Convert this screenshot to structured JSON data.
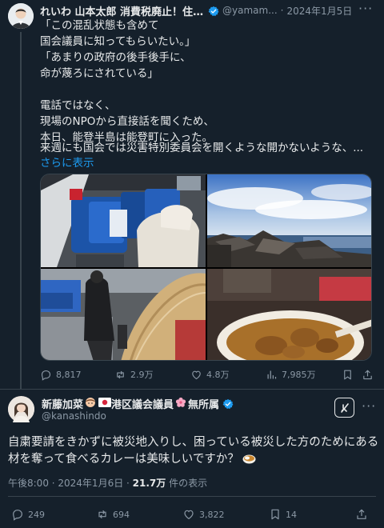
{
  "tweet1": {
    "name": "れいわ 山本太郎 消費税廃止！住ま...",
    "handle": "@yamam...",
    "date": "2024年1月5日",
    "lines": [
      "「この混乱状態も含めて",
      "国会議員に知ってもらいたい。」",
      "「あまりの政府の後手後手に、",
      "命が蔑ろにされている」",
      "",
      "電話ではなく、",
      "現場のNPOから直接話を聞くため、",
      "本日、能登半島は能登町に入った。",
      "",
      "来週にも国会では災害特別委員会を開くような開かないような、..."
    ],
    "show_more": "さらに表示",
    "stats": {
      "replies": "8,817",
      "reposts": "2.9万",
      "likes": "4.8万",
      "views": "7,985万"
    }
  },
  "tweet2": {
    "name": "新藤加菜",
    "name_suffix1": "港区議会議員",
    "name_suffix2": "無所属",
    "handle": "@kanashindo",
    "text_lines": [
      "自粛要請をきかずに被災地入りし、困っている被災した方のためにある食",
      "材を奪って食べるカレーは美味しいですか？"
    ],
    "time": "午後8:00 · 2024年1月6日 · ",
    "views_count": "21.7万",
    "views_label": " 件の表示",
    "stats": {
      "replies": "249",
      "reposts": "694",
      "likes": "3,822",
      "bookmarks": "14"
    }
  },
  "colors": {
    "background": "#15202b",
    "text": "#e7e9ea",
    "muted": "#8b98a5",
    "accent": "#1d9bf0",
    "border": "#38444d"
  },
  "icons": [
    "verified-badge-icon",
    "more-icon",
    "reply-icon",
    "repost-icon",
    "like-icon",
    "views-icon",
    "bookmark-icon",
    "share-icon",
    "grok-icon",
    "japan-flag-icon",
    "cherry-blossom-icon",
    "curry-icon",
    "girl-emoji-icon"
  ]
}
